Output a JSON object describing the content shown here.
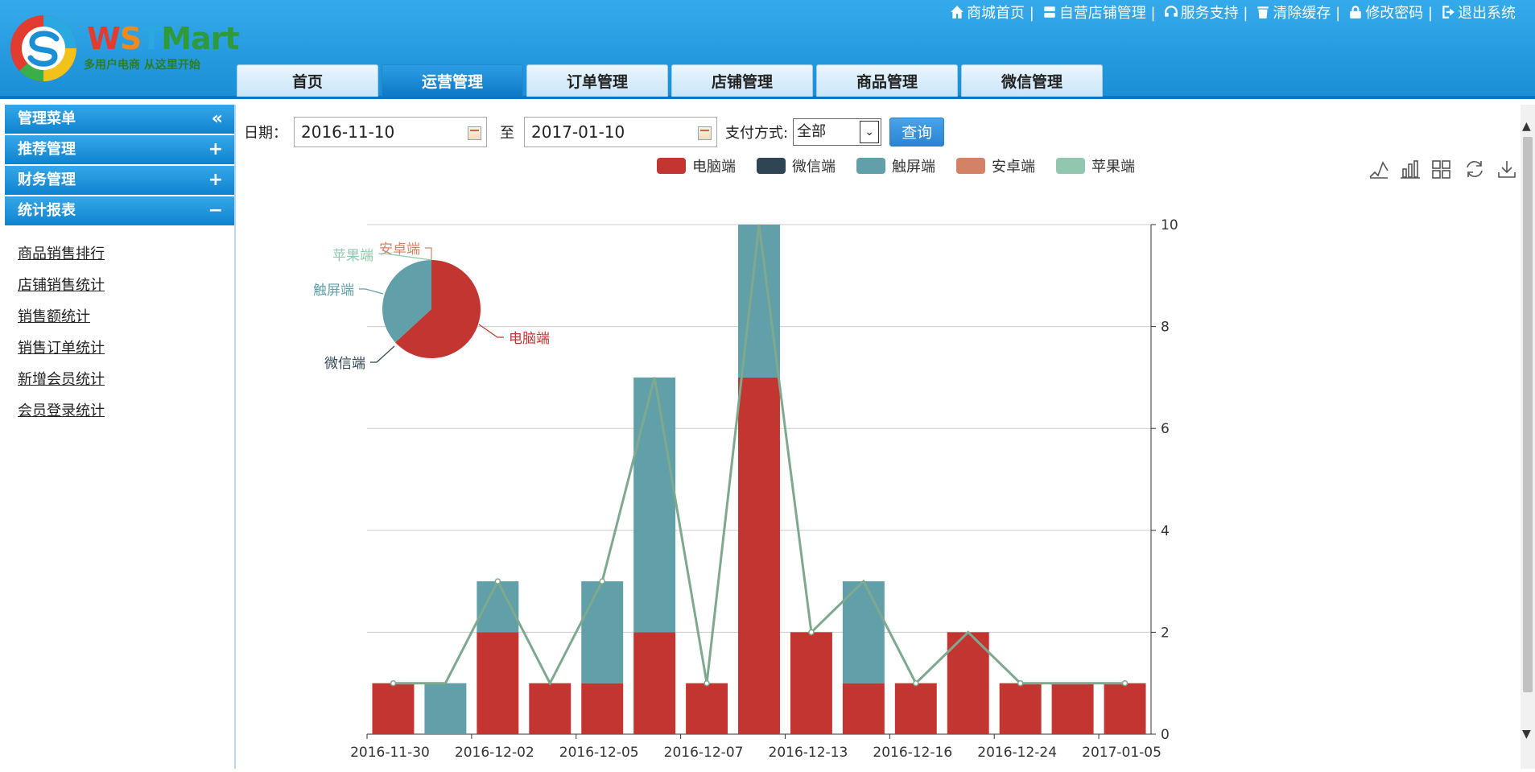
{
  "header": {
    "logo_text": "WSTMart",
    "logo_slogan": "多用户电商 从这里开始",
    "top_links": [
      {
        "label": "商城首页 |",
        "icon": "home-icon"
      },
      {
        "label": "自营店铺管理 |",
        "icon": "store-icon"
      },
      {
        "label": "服务支持 |",
        "icon": "headset-icon"
      },
      {
        "label": "清除缓存 |",
        "icon": "trash-icon"
      },
      {
        "label": "修改密码 |",
        "icon": "lock-icon"
      },
      {
        "label": "退出系统",
        "icon": "logout-icon"
      }
    ],
    "tabs": [
      {
        "label": "首页",
        "active": false
      },
      {
        "label": "运营管理",
        "active": true
      },
      {
        "label": "订单管理",
        "active": false
      },
      {
        "label": "店铺管理",
        "active": false
      },
      {
        "label": "商品管理",
        "active": false
      },
      {
        "label": "微信管理",
        "active": false
      }
    ]
  },
  "sidebar": {
    "title": "管理菜单",
    "title_toggle": "«",
    "sections": [
      {
        "label": "推荐管理",
        "toggle": "+"
      },
      {
        "label": "财务管理",
        "toggle": "+"
      },
      {
        "label": "统计报表",
        "toggle": "−"
      }
    ],
    "links": [
      "商品销售排行",
      "店铺销售统计",
      "销售额统计",
      "销售订单统计",
      "新增会员统计",
      "会员登录统计"
    ]
  },
  "filter": {
    "date_label": "日期：",
    "start_date": "2016-11-10",
    "to_label": "至",
    "end_date": "2017-01-10",
    "pay_label": "支付方式:",
    "pay_value": "全部",
    "query_label": "查询"
  },
  "toolbox": [
    "line-chart-icon",
    "bar-chart-icon",
    "tiled-icon",
    "refresh-icon",
    "download-icon"
  ],
  "colors": {
    "pc": "#c23531",
    "wechat": "#2f4554",
    "touch": "#61a0a8",
    "android": "#d48265",
    "apple": "#91c7ae",
    "line": "#7fa98e"
  },
  "chart_data": {
    "type": "bar",
    "stacked": true,
    "y_axis_position": "right",
    "ylim": [
      0,
      10
    ],
    "yticks": [
      0,
      2,
      4,
      6,
      8,
      10
    ],
    "grid": true,
    "legend": [
      "电脑端",
      "微信端",
      "触屏端",
      "安卓端",
      "苹果端"
    ],
    "legend_placement": "top-center",
    "x_tick_labels": [
      "2016-11-30",
      "2016-12-02",
      "2016-12-05",
      "2016-12-07",
      "2016-12-13",
      "2016-12-16",
      "2016-12-24",
      "2017-01-05"
    ],
    "series": [
      {
        "name": "电脑端",
        "values": [
          1,
          0,
          2,
          1,
          1,
          2,
          1,
          7,
          2,
          1,
          1,
          2,
          1,
          1,
          1
        ]
      },
      {
        "name": "微信端",
        "values": [
          0,
          0,
          0,
          0,
          0,
          0,
          0,
          0,
          0,
          0,
          0,
          0,
          0,
          0,
          0
        ]
      },
      {
        "name": "触屏端",
        "values": [
          0,
          1,
          1,
          0,
          2,
          5,
          0,
          3,
          0,
          2,
          0,
          0,
          0,
          0,
          0
        ]
      },
      {
        "name": "安卓端",
        "values": [
          0,
          0,
          0,
          0,
          0,
          0,
          0,
          0,
          0,
          0,
          0,
          0,
          0,
          0,
          0
        ]
      },
      {
        "name": "苹果端",
        "values": [
          0,
          0,
          0,
          0,
          0,
          0,
          0,
          0,
          0,
          0,
          0,
          0,
          0,
          0,
          0
        ]
      }
    ],
    "total_line": [
      1,
      1,
      3,
      1,
      3,
      7,
      1,
      10,
      2,
      3,
      1,
      2,
      1,
      1,
      1
    ],
    "pie": {
      "slices": [
        {
          "name": "电脑端",
          "value": 24
        },
        {
          "name": "微信端",
          "value": 0
        },
        {
          "name": "触屏端",
          "value": 14
        },
        {
          "name": "安卓端",
          "value": 0
        },
        {
          "name": "苹果端",
          "value": 0
        }
      ]
    }
  }
}
